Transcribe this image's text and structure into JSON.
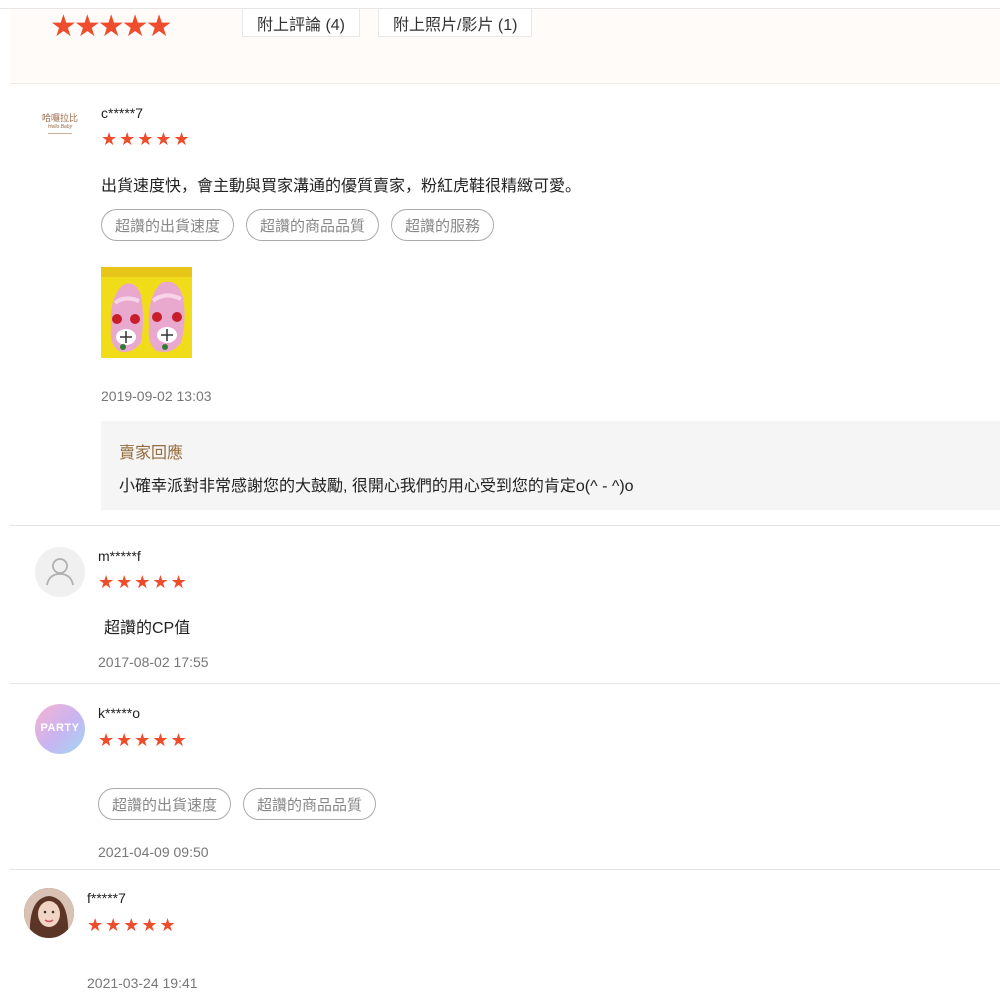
{
  "filter_bar": {
    "stars": "★★★★★",
    "with_comment": "附上評論 (4)",
    "with_media": "附上照片/影片 (1)"
  },
  "reviews": [
    {
      "username": "c*****7",
      "avatar_text": "哈囉拉比",
      "avatar_subtext": "Hello Baby",
      "stars": "★★★★★",
      "rating": 5,
      "comment": "出貨速度快，會主動與買家溝通的優質賣家，粉紅虎鞋很精緻可愛。",
      "tags": [
        "超讚的出貨速度",
        "超讚的商品品質",
        "超讚的服務"
      ],
      "date": "2019-09-02 13:03",
      "seller_reply": {
        "title": "賣家回應",
        "text": "小確幸派對非常感謝您的大鼓勵, 很開心我們的用心受到您的肯定o(^ - ^)o"
      }
    },
    {
      "username": "m*****f",
      "stars": "★★★★★",
      "rating": 5,
      "comment": "超讚的CP值",
      "date": "2017-08-02 17:55"
    },
    {
      "username": "k*****o",
      "avatar_text": "PARTY",
      "stars": "★★★★★",
      "rating": 5,
      "tags": [
        "超讚的出貨速度",
        "超讚的商品品質"
      ],
      "date": "2021-04-09 09:50"
    },
    {
      "username": "f*****7",
      "stars": "★★★★★",
      "rating": 5,
      "date": "2021-03-24 19:41"
    }
  ],
  "colors": {
    "star": "#ee4d2d",
    "reply_title": "#946b3c",
    "filter_bg": "#fffbf8"
  }
}
